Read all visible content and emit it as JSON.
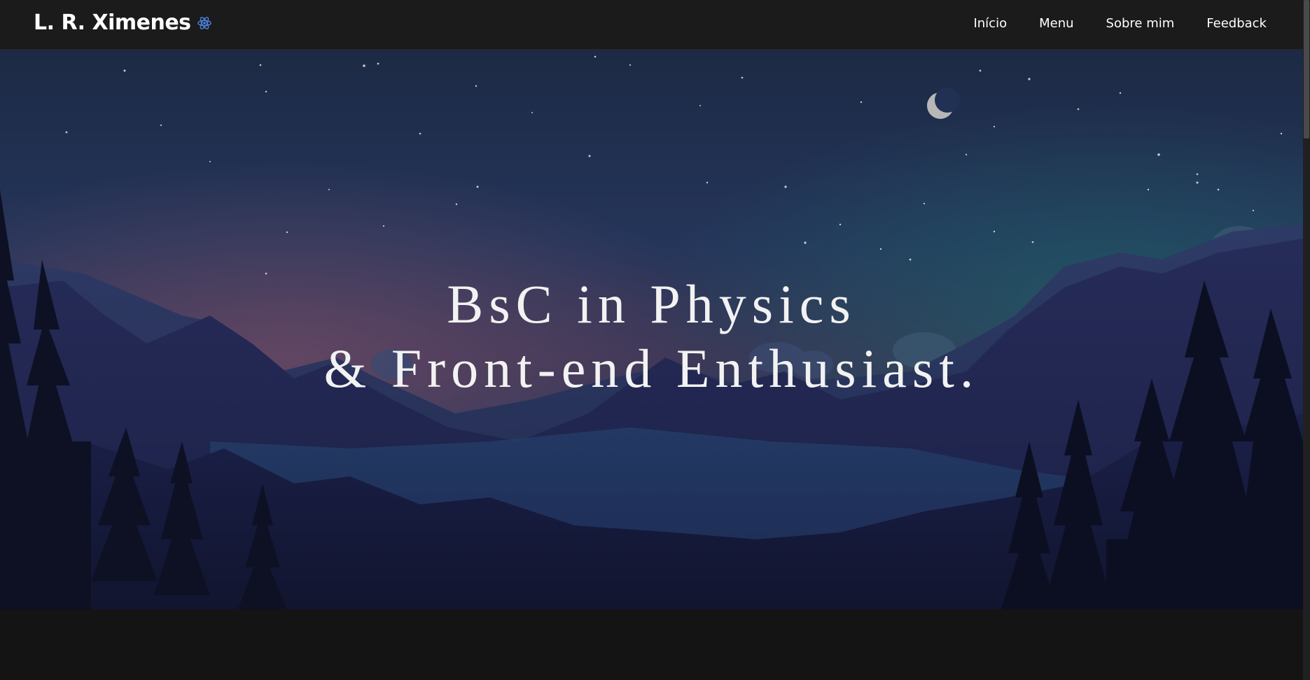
{
  "navbar": {
    "brand": "L. R. Ximenes",
    "brand_icon": "atom-icon",
    "links": [
      {
        "label": "Início"
      },
      {
        "label": "Menu"
      },
      {
        "label": "Sobre mim"
      },
      {
        "label": "Feedback"
      }
    ]
  },
  "hero": {
    "headline_line1": "BsC in Physics",
    "headline_line2": "& Front-end Enthusiast.",
    "background": "night-mountain-landscape",
    "moon_icon": "crescent-moon"
  },
  "colors": {
    "navbar_bg": "#1b1b1b",
    "page_bg": "#141414",
    "accent_icon": "#4a7fd6",
    "text": "#ffffff"
  }
}
